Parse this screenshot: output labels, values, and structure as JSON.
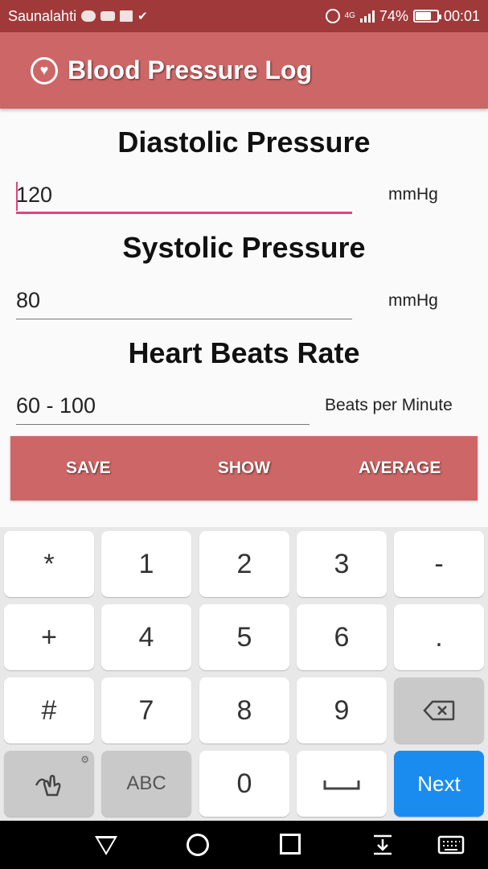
{
  "status_bar": {
    "carrier": "Saunalahti",
    "network": "4G",
    "battery": "74%",
    "battery_level": 0.74,
    "time": "00:01"
  },
  "app_bar": {
    "title": "Blood Pressure Log",
    "icon": "heart-icon"
  },
  "form": {
    "diastolic": {
      "title": "Diastolic Pressure",
      "value": "120",
      "unit": "mmHg"
    },
    "systolic": {
      "title": "Systolic Pressure",
      "value": "80",
      "unit": "mmHg"
    },
    "heart_rate": {
      "title": "Heart Beats Rate",
      "value": "60 - 100",
      "unit": "Beats per Minute"
    }
  },
  "buttons": {
    "save": "SAVE",
    "show": "SHOW",
    "average": "AVERAGE"
  },
  "keyboard": {
    "row1": [
      "*",
      "1",
      "2",
      "3",
      "-"
    ],
    "row2": [
      "+",
      "4",
      "5",
      "6",
      "."
    ],
    "row3": [
      "#",
      "7",
      "8",
      "9"
    ],
    "row4_abc": "ABC",
    "row4_zero": "0",
    "next": "Next"
  },
  "colors": {
    "status_bar": "#a03a3a",
    "primary": "#cd6666",
    "accent": "#e0457b",
    "next_key": "#1a8cf0"
  }
}
